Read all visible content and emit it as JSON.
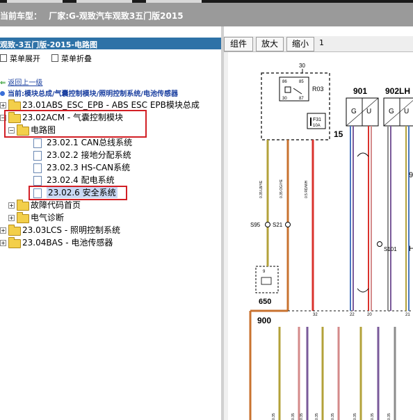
{
  "header": {
    "vehicle_label": "当前车型：",
    "vehicle_value": "厂家:G-观致汽车观致3五门版2015"
  },
  "left_panel": {
    "title": "观致-3五门版-2015-电路图",
    "menu": {
      "expand_label": "菜单展开",
      "collapse_label": "菜单折叠"
    },
    "back_link": "返回上一级",
    "current_path": "当前:模块总成/气囊控制模块/照明控制系统/电池传感器",
    "tree": [
      {
        "id": "abs",
        "label": "23.01ABS_ESC_EPB - ABS ESC EPB模块总成",
        "level": 0,
        "type": "folder",
        "expander": "+"
      },
      {
        "id": "acm",
        "label": "23.02ACM - 气囊控制模块",
        "level": 0,
        "type": "folder",
        "expander": "-"
      },
      {
        "id": "circuit",
        "label": "电路图",
        "level": 1,
        "type": "folder",
        "expander": "-"
      },
      {
        "id": "can",
        "label": "23.02.1 CAN总线系统",
        "level": 2,
        "type": "doc"
      },
      {
        "id": "ground",
        "label": "23.02.2 接地分配系统",
        "level": 2,
        "type": "doc"
      },
      {
        "id": "hscan",
        "label": "23.02.3 HS-CAN系统",
        "level": 2,
        "type": "doc"
      },
      {
        "id": "power",
        "label": "23.02.4 配电系统",
        "level": 2,
        "type": "doc"
      },
      {
        "id": "safety",
        "label": "23.02.6 安全系统",
        "level": 2,
        "type": "doc",
        "selected": true
      },
      {
        "id": "dtc",
        "label": "故障代码首页",
        "level": 1,
        "type": "folder",
        "expander": "+"
      },
      {
        "id": "diag",
        "label": "电气诊断",
        "level": 1,
        "type": "folder",
        "expander": "+"
      },
      {
        "id": "lcs",
        "label": "23.03LCS - 照明控制系统",
        "level": 0,
        "type": "folder",
        "expander": "+"
      },
      {
        "id": "bas",
        "label": "23.04BAS - 电池传感器",
        "level": 0,
        "type": "folder",
        "expander": "+"
      }
    ]
  },
  "right_panel": {
    "toolbar": {
      "component_label": "组件",
      "zoom_in_label": "放大",
      "zoom_out_label": "缩小",
      "page": "1"
    },
    "diagram": {
      "labels": {
        "pin_top": "30",
        "relay": "R03",
        "relay_pin_86": "86",
        "relay_pin_85": "85",
        "relay_pin_30": "30",
        "relay_pin_87": "87",
        "fuse": "F31",
        "fuse_rating": "10A",
        "module_15": "15",
        "module_901": "901",
        "module_902": "902LH",
        "splice_s95": "S95",
        "splice_s21": "S21",
        "splice_s101": "S101",
        "connector_650": "650",
        "connector_900": "900",
        "g_label": "G",
        "u_label": "U",
        "edge_9": "9",
        "edge_h": "H",
        "pin_32": "32",
        "pin_22": "22",
        "pin_20": "20",
        "pin_21": "21",
        "pin_9": "9"
      },
      "colors": {
        "red": "#d9322c",
        "orange": "#c8722f",
        "olive": "#b3a23a",
        "purple": "#7a5a9a",
        "pink": "#d48a8a",
        "gray": "#8c8c8c",
        "blue": "#4a78c0",
        "black": "#111111"
      }
    }
  },
  "colors": {
    "title_bar": "#2e72a7",
    "vehicle_bar": "#9a9a9a",
    "highlight": "#d21f25",
    "link": "#1a3fa0"
  }
}
